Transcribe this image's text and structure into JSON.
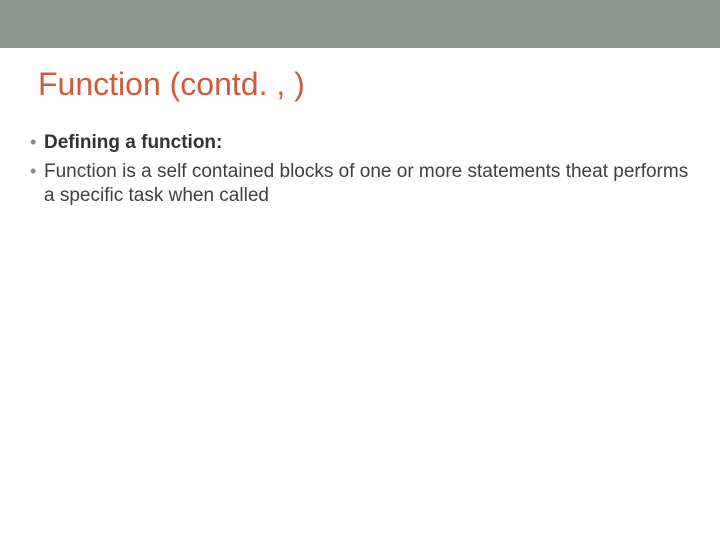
{
  "slide": {
    "title": "Function (contd. , )",
    "bullets": [
      {
        "text": "Defining a function:",
        "bold": true
      },
      {
        "text": "Function is a self contained blocks of one or more statements theat performs a specific task when called",
        "bold": false
      }
    ]
  },
  "colors": {
    "topbar": "#8d998d",
    "title": "#d05a3c",
    "text": "#3f3f3f"
  }
}
